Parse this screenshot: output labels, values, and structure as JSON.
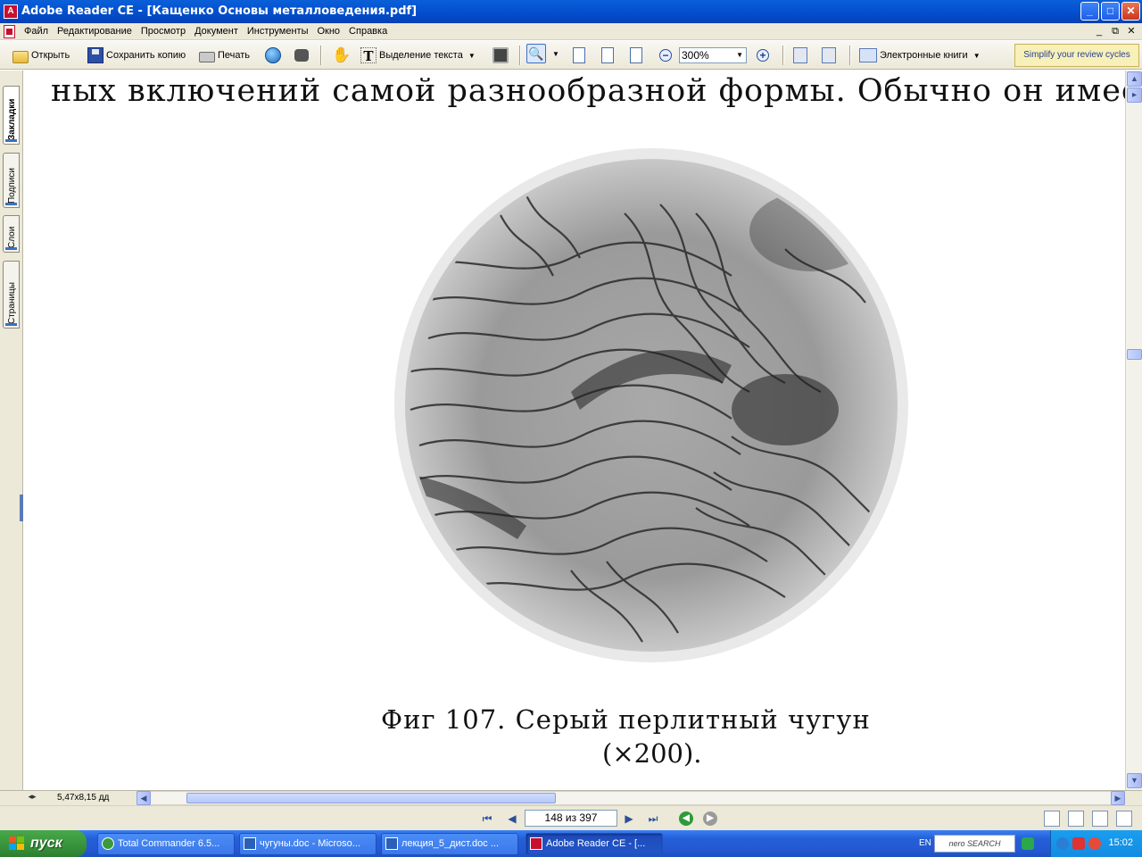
{
  "window": {
    "title": "Adobe Reader CE - [Кащенко Основы металловедения.pdf]",
    "app_icon_label": "A",
    "controls": {
      "minimize": "_",
      "maximize": "□",
      "close": "✕"
    }
  },
  "menubar": {
    "items": [
      "Файл",
      "Редактирование",
      "Просмотр",
      "Документ",
      "Инструменты",
      "Окно",
      "Справка"
    ],
    "mdi_controls": {
      "minimize": "_",
      "restore": "⧉",
      "close": "✕"
    }
  },
  "toolbar": {
    "open_label": "Открыть",
    "save_copy_label": "Сохранить копию",
    "print_label": "Печать",
    "select_text_label": "Выделение текста",
    "zoom_value": "300%",
    "ebooks_label": "Электронные книги",
    "promo_label": "Simplify your review cycles",
    "zoom_out_symbol": "−",
    "zoom_in_symbol": "+",
    "zoom_tool_symbol": "🔍"
  },
  "nav_tabs": [
    "Закладки",
    "Подписи",
    "Слои",
    "Страницы"
  ],
  "document": {
    "top_line": "ных включений самой разнообразной формы. Обычно он имеет ф",
    "caption_line1": "Фиг  107. Серый  перлитный  чугун",
    "caption_line2": "(×200)."
  },
  "status": {
    "page_size": "5,47x8,15 дд",
    "page_indicator": "148 из 397",
    "first_page": "⏮",
    "prev_page": "◀",
    "next_page": "▶",
    "last_page": "⏭",
    "back": "◀",
    "forward": "▶"
  },
  "taskbar": {
    "start_label": "пуск",
    "tasks": [
      {
        "label": "Total Commander 6.5...",
        "color": "#3a9a3a"
      },
      {
        "label": "чугуны.doc - Microso...",
        "color": "#2b5fb8"
      },
      {
        "label": "лекция_5_дист.doc ...",
        "color": "#2b5fb8"
      },
      {
        "label": "Adobe Reader CE - [...",
        "color": "#c8102e"
      }
    ],
    "language": "EN",
    "search_label": "nero SEARCH",
    "clock": "15:02"
  },
  "colors": {
    "titlebar": "#0453d1",
    "chrome": "#ece9d8",
    "taskbar": "#2560d8",
    "start": "#37923a",
    "promo_bg": "#f7f0b8"
  }
}
